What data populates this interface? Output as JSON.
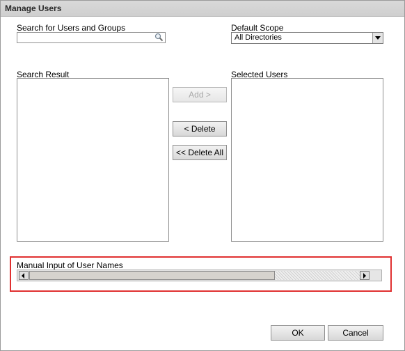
{
  "window": {
    "title": "Manage Users"
  },
  "search": {
    "label": "Search for Users and Groups",
    "value": "",
    "icon": "search-icon"
  },
  "scope": {
    "label": "Default Scope",
    "selected": "All Directories"
  },
  "search_result": {
    "label": "Search Result",
    "items": []
  },
  "selected_users": {
    "label": "Selected Users",
    "items": []
  },
  "buttons": {
    "add": "Add >",
    "delete": "< Delete",
    "delete_all": "<< Delete All",
    "ok": "OK",
    "cancel": "Cancel"
  },
  "manual_input": {
    "label": "Manual Input of User Names",
    "highlight_color": "#e03030"
  }
}
